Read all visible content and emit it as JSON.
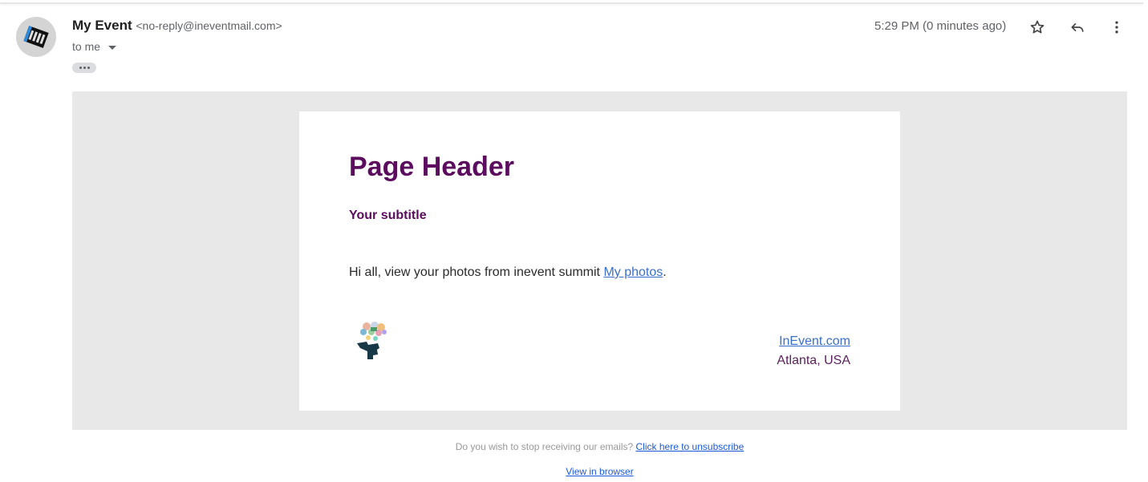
{
  "header": {
    "sender_name": "My Event",
    "sender_email": "<no-reply@ineventmail.com>",
    "recipient": "to me",
    "timestamp": "5:29 PM (0 minutes ago)",
    "actions": {
      "star": "star-icon",
      "reply": "reply-icon",
      "more": "more-vert-icon"
    }
  },
  "email": {
    "page_header": "Page Header",
    "subtitle": "Your subtitle",
    "body_prefix": "Hi all, view your photos from inevent summit ",
    "body_link": "My photos",
    "body_suffix": ".",
    "footer_link": "InEvent.com",
    "location": "Atlanta, USA"
  },
  "bottom": {
    "unsubscribe_question": "Do you wish to stop receiving our emails? ",
    "unsubscribe_link": "Click here to unsubscribe",
    "view_in_browser": "View in browser"
  },
  "colors": {
    "heading": "#5b0c5e",
    "link": "#3a6fc9",
    "background_gray": "#e8e8e8"
  }
}
